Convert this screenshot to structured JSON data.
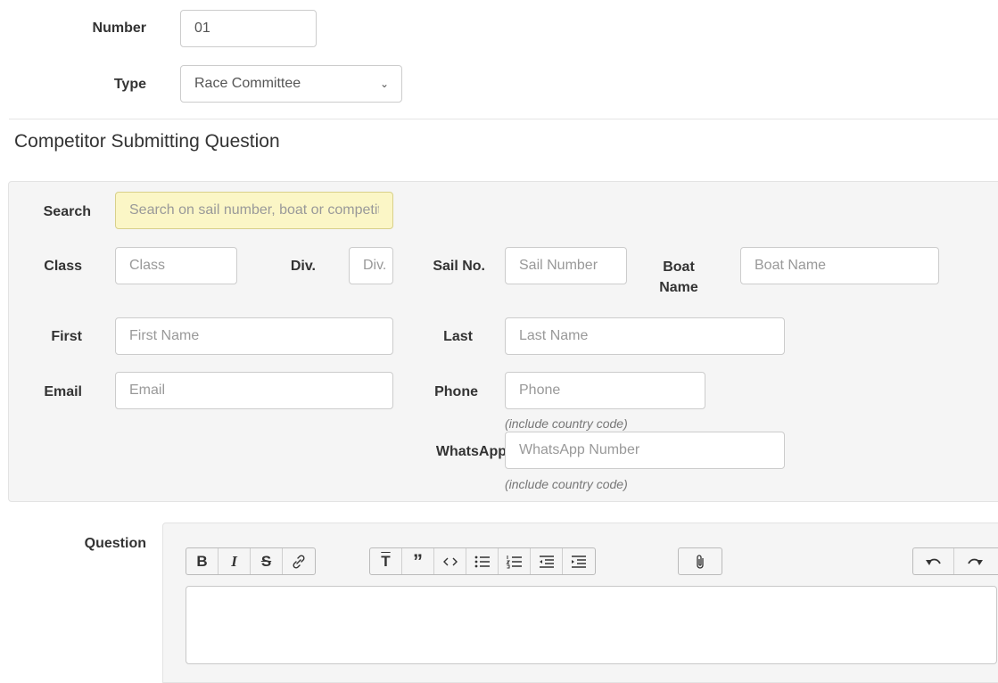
{
  "form": {
    "number_label": "Number",
    "number_value": "01",
    "type_label": "Type",
    "type_value": "Race Committee"
  },
  "section_title": "Competitor Submitting Question",
  "competitor": {
    "search_label": "Search",
    "search_placeholder": "Search on sail number, boat or competitor",
    "class_label": "Class",
    "class_placeholder": "Class",
    "div_label": "Div.",
    "div_placeholder": "Div.",
    "sail_label": "Sail No.",
    "sail_placeholder": "Sail Number",
    "boat_label_1": "Boat",
    "boat_label_2": "Name",
    "boat_placeholder": "Boat Name",
    "first_label": "First",
    "first_placeholder": "First Name",
    "last_label": "Last",
    "last_placeholder": "Last Name",
    "email_label": "Email",
    "email_placeholder": "Email",
    "phone_label": "Phone",
    "phone_placeholder": "Phone",
    "phone_hint": "(include country code)",
    "whatsapp_label": "WhatsApp",
    "whatsapp_placeholder": "WhatsApp Number",
    "whatsapp_hint": "(include country code)"
  },
  "question": {
    "label": "Question",
    "value": ""
  },
  "toolbar": {
    "bold": "B",
    "italic": "I",
    "strike": "S",
    "heading": "T",
    "quote": "”"
  },
  "colors": {
    "search_bg": "#fbf6c6",
    "panel_bg": "#f5f5f5"
  }
}
